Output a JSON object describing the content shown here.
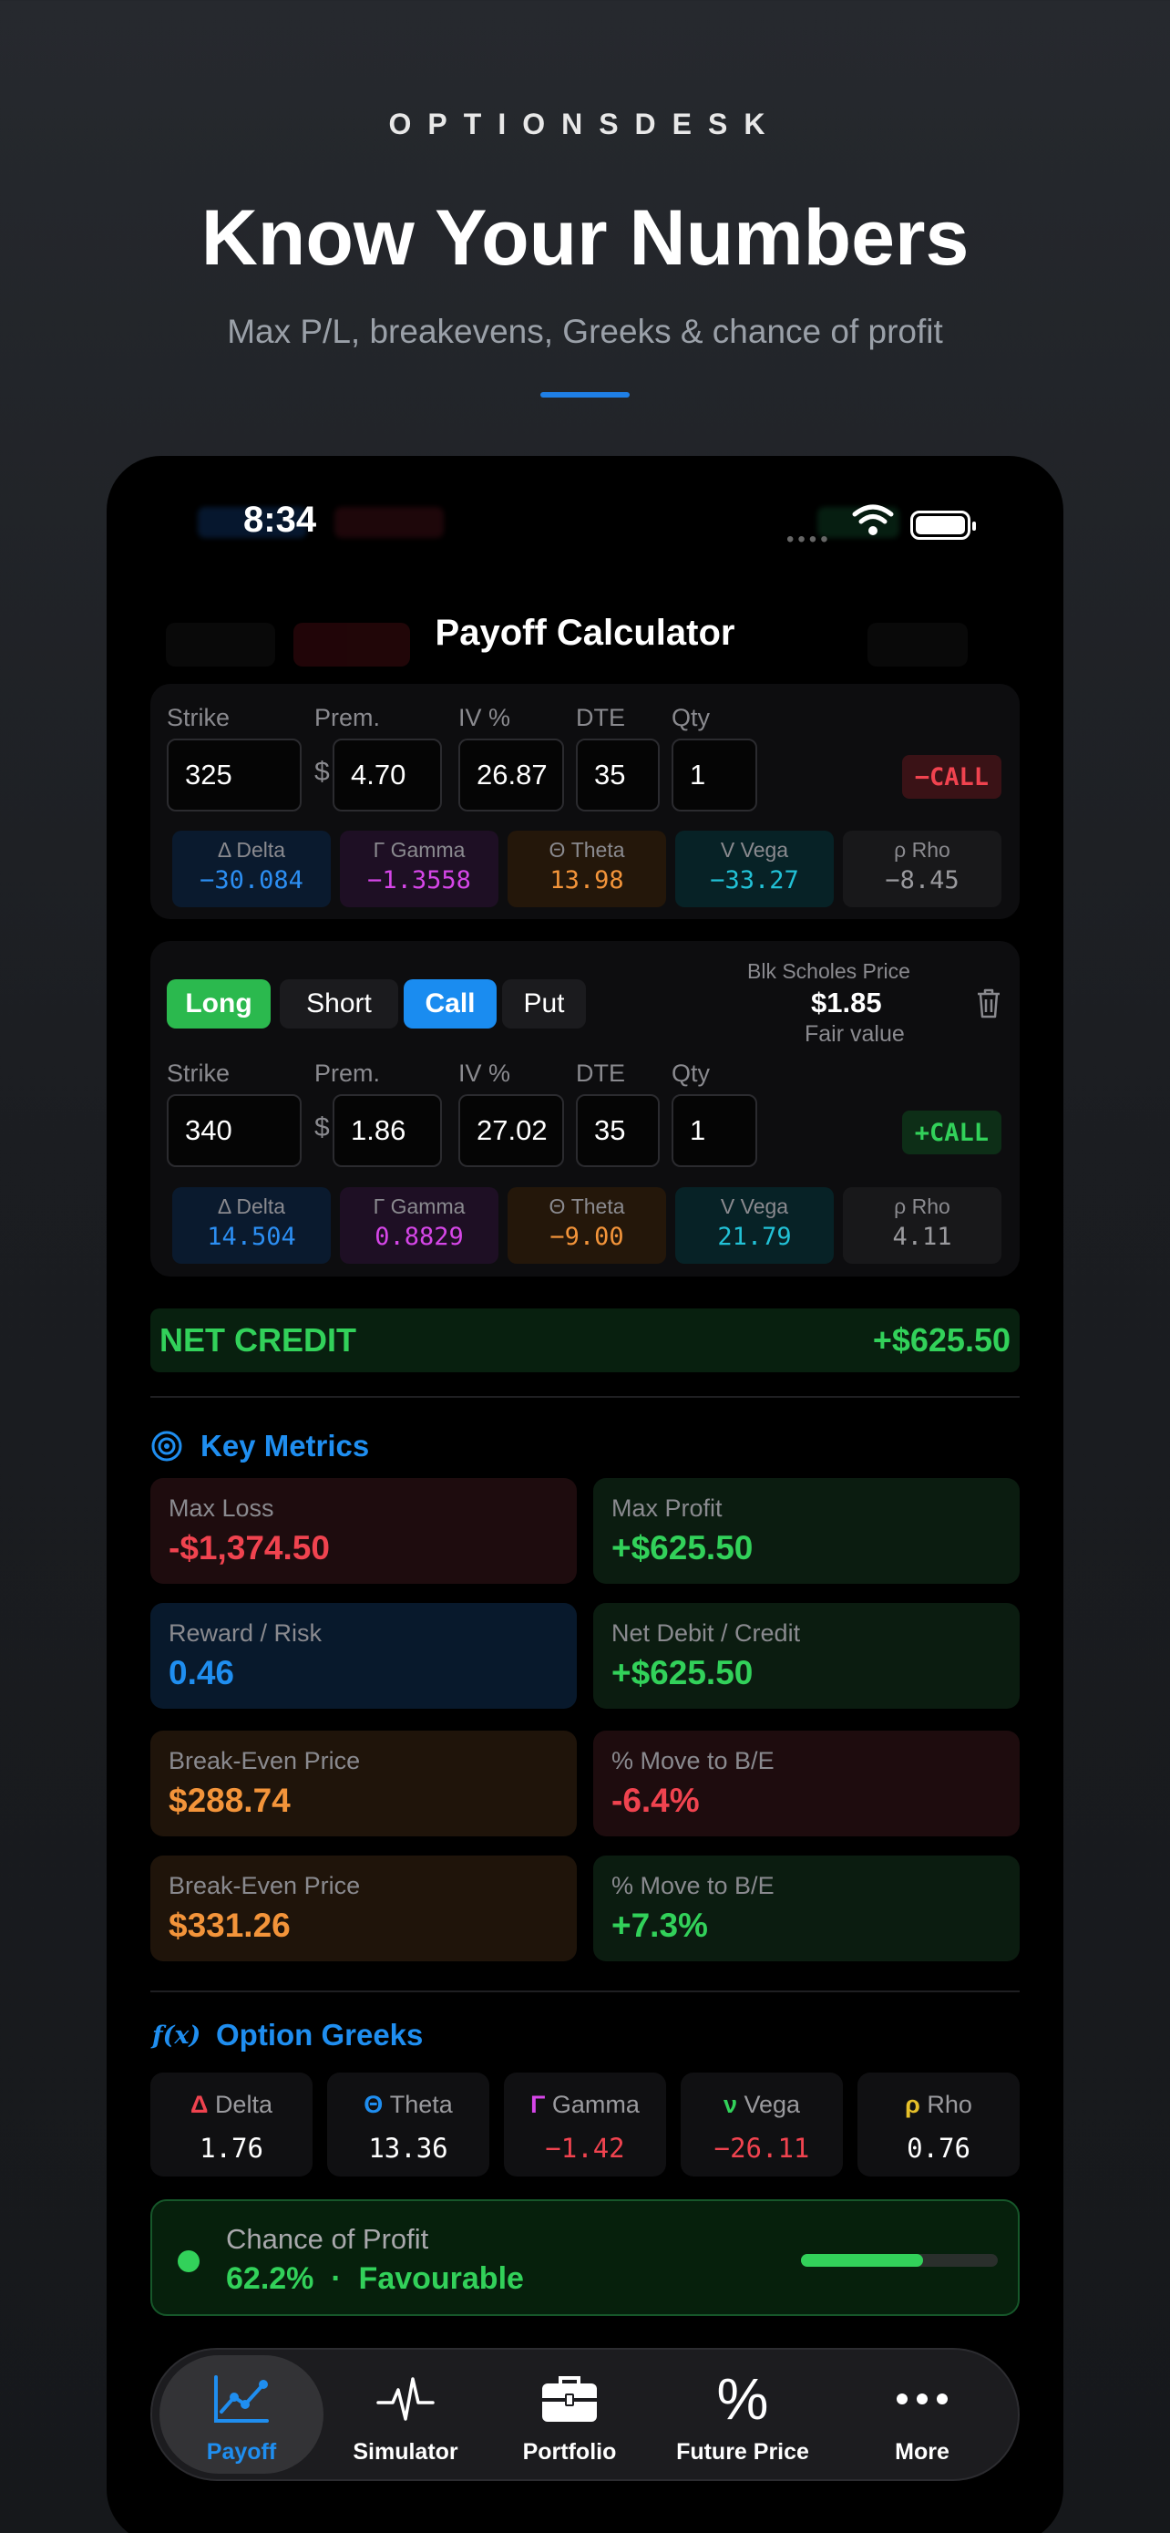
{
  "promo": {
    "brand": "OPTIONSDESK",
    "title": "Know Your Numbers",
    "subtitle": "Max P/L, breakevens, Greeks & chance of profit"
  },
  "status_bar": {
    "time": "8:34",
    "dots": "••••"
  },
  "header": {
    "title": "Payoff Calculator"
  },
  "field_labels": {
    "strike": "Strike",
    "premium": "Prem.",
    "iv": "IV %",
    "dte": "DTE",
    "qty": "Qty",
    "currency": "$"
  },
  "legs": [
    {
      "strike": "325",
      "premium": "4.70",
      "iv": "26.87",
      "dte": "35",
      "qty": "1",
      "badge": "−CALL",
      "greeks": [
        {
          "label": "Δ Delta",
          "value": "−30.084"
        },
        {
          "label": "Γ Gamma",
          "value": "−1.3558"
        },
        {
          "label": "Θ Theta",
          "value": "13.98"
        },
        {
          "label": "V Vega",
          "value": "−33.27"
        },
        {
          "label": "ρ Rho",
          "value": "−8.45"
        }
      ]
    },
    {
      "toggles": {
        "long": "Long",
        "short": "Short",
        "call": "Call",
        "put": "Put"
      },
      "bs_label": "Blk Scholes Price",
      "bs_price": "$1.85",
      "bs_sub": "Fair value",
      "strike": "340",
      "premium": "1.86",
      "iv": "27.02",
      "dte": "35",
      "qty": "1",
      "badge": "+CALL",
      "greeks": [
        {
          "label": "Δ Delta",
          "value": "14.504"
        },
        {
          "label": "Γ Gamma",
          "value": "0.8829"
        },
        {
          "label": "Θ Theta",
          "value": "−9.00"
        },
        {
          "label": "V Vega",
          "value": "21.79"
        },
        {
          "label": "ρ Rho",
          "value": "4.11"
        }
      ]
    }
  ],
  "net": {
    "label": "NET CREDIT",
    "value": "+$625.50"
  },
  "key_metrics": {
    "title": "Key Metrics",
    "items": [
      {
        "label": "Max Loss",
        "value": "-$1,374.50"
      },
      {
        "label": "Max Profit",
        "value": "+$625.50"
      },
      {
        "label": "Reward / Risk",
        "value": "0.46"
      },
      {
        "label": "Net Debit / Credit",
        "value": "+$625.50"
      },
      {
        "label": "Break-Even Price",
        "value": "$288.74"
      },
      {
        "label": "% Move to B/E",
        "value": "-6.4%"
      },
      {
        "label": "Break-Even Price",
        "value": "$331.26"
      },
      {
        "label": "% Move to B/E",
        "value": "+7.3%"
      }
    ]
  },
  "option_greeks": {
    "icon_text": "f(x)",
    "title": "Option Greeks",
    "items": [
      {
        "symbol": "Δ",
        "name": "Delta",
        "value": "1.76"
      },
      {
        "symbol": "Θ",
        "name": "Theta",
        "value": "13.36"
      },
      {
        "symbol": "Γ",
        "name": "Gamma",
        "value": "−1.42"
      },
      {
        "symbol": "ν",
        "name": "Vega",
        "value": "−26.11"
      },
      {
        "symbol": "ρ",
        "name": "Rho",
        "value": "0.76"
      }
    ]
  },
  "chance_of_profit": {
    "label": "Chance of Profit",
    "value": "62.2%",
    "separator": "·",
    "verdict": "Favourable",
    "fraction": 0.622
  },
  "tabs": [
    {
      "label": "Payoff",
      "icon": "chart-line-icon"
    },
    {
      "label": "Simulator",
      "icon": "pulse-icon"
    },
    {
      "label": "Portfolio",
      "icon": "briefcase-icon"
    },
    {
      "label": "Future Price",
      "icon": "percent-icon"
    },
    {
      "label": "More",
      "icon": "ellipsis-icon"
    }
  ],
  "colors": {
    "accent": "#1f8ef0",
    "green": "#32d15a",
    "red": "#f0434f",
    "orange": "#f3943a",
    "magenta": "#d646e8",
    "cyan": "#22c1d6",
    "yellow": "#e6c02a"
  }
}
